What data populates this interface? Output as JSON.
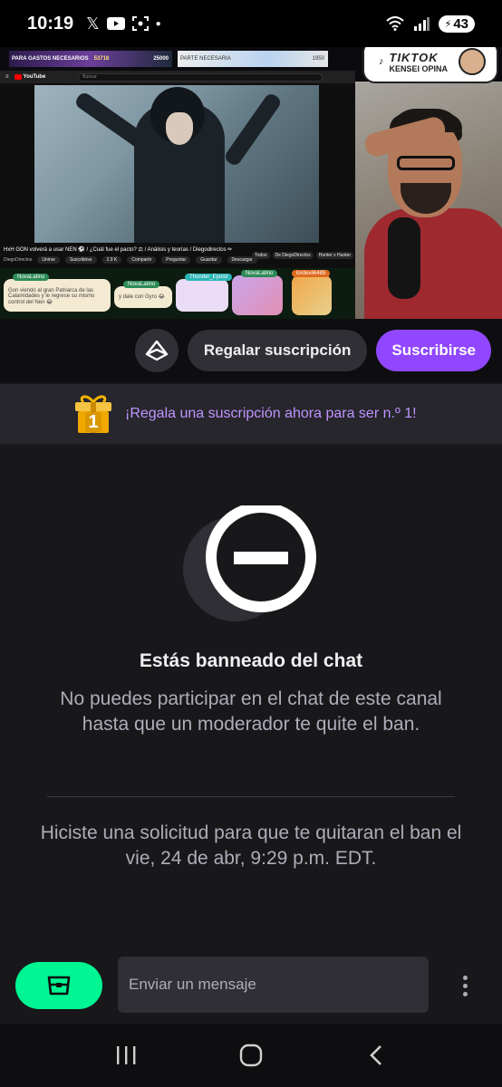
{
  "status": {
    "time": "10:19",
    "battery": "43"
  },
  "video": {
    "tickers": [
      "PARA GASTOS NECESARIOS",
      "53718",
      "25000",
      "PARTE NECESARIA",
      "1950"
    ],
    "yt": {
      "logo": "YouTube",
      "search_placeholder": "Buscar",
      "title": "HxH GON volverá a usar NEN ⚽ / ¿Cuál fue el pacto? ⚖ / Análisis y teorías / Diegodirectos ✏",
      "channel": "DiegoDirectos",
      "chips": [
        "Unirse",
        "Suscribirse",
        "2.9 K",
        "Compartir",
        "Preguntar",
        "Guardar",
        "Descargar"
      ],
      "right_chips": [
        "Todos",
        "De DiegoDirectos",
        "Hunter x Hunter"
      ]
    },
    "chat": [
      {
        "name": "NovaLatino",
        "text": "Gon viendo al gran Patriarca de las Calamidades y le regrese su mismo control del Nen 😂"
      },
      {
        "name": "NovaLatino",
        "text": "y dale con Gyro 😂"
      },
      {
        "name": "Thunder_Epoist",
        "text": ""
      },
      {
        "name": "NovaLatino",
        "text": ""
      },
      {
        "name": "lordevil6485",
        "text": ""
      }
    ],
    "tiktok": {
      "title": "TIKTOK",
      "subtitle": "KENSEI OPINA"
    }
  },
  "actions": {
    "gift_sub": "Regalar suscripción",
    "subscribe": "Suscribirse"
  },
  "gift_banner": {
    "badge": "1",
    "text": "¡Regala una suscripción ahora para ser n.º 1!"
  },
  "ban": {
    "title": "Estás banneado del chat",
    "description": "No puedes participar en el chat de este canal hasta que un moderador te quite el ban.",
    "request": "Hiciste una solicitud para que te quitaran el ban el vie, 24 de abr, 9:29 p.m. EDT."
  },
  "chat_input": {
    "placeholder": "Enviar un mensaje"
  },
  "colors": {
    "accent": "#9147ff",
    "bits": "#00f593",
    "background": "#18181b"
  }
}
